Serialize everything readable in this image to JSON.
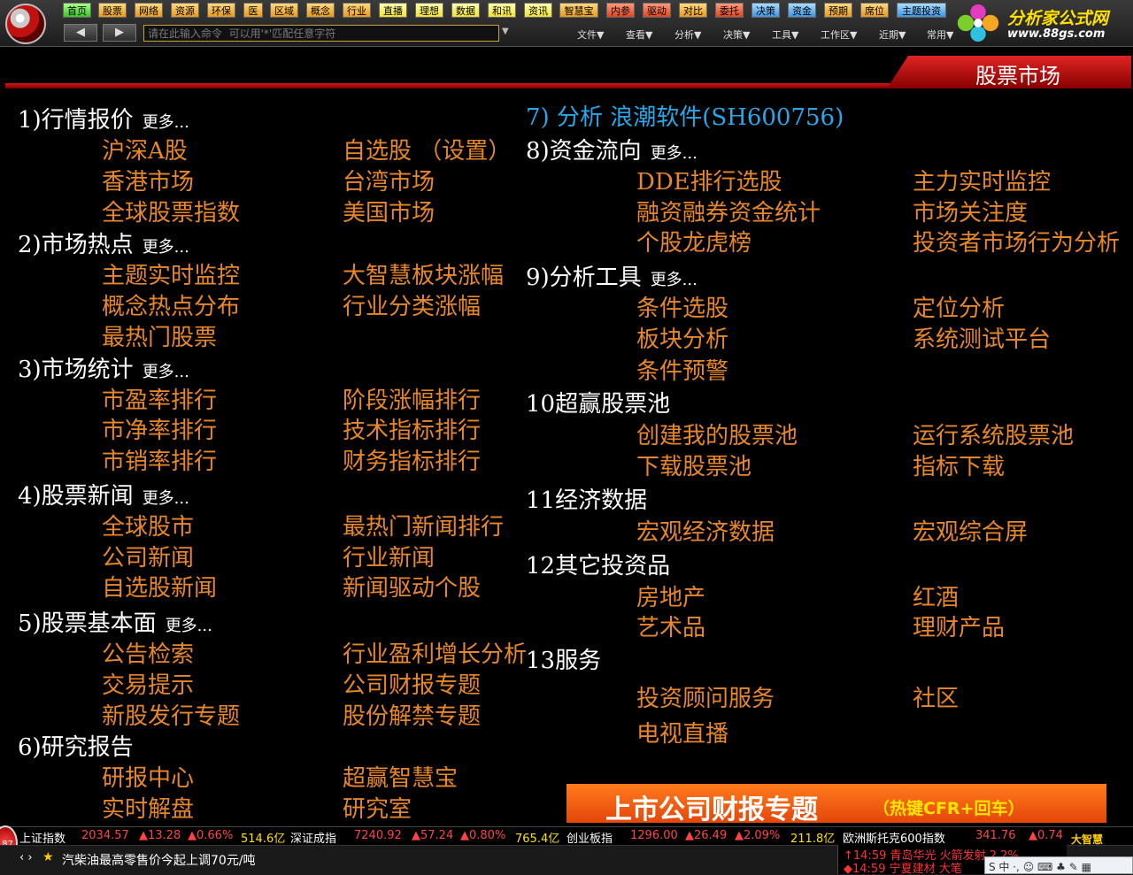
{
  "toolbar": {
    "nav_buttons": [
      "首页",
      "股票",
      "网络",
      "资源",
      "环保",
      "医",
      "区域",
      "概念",
      "行业",
      "直播",
      "理想",
      "数据",
      "和讯",
      "资讯",
      "智慧宝",
      "内参",
      "驱动",
      "对比",
      "委托",
      "决策",
      "资金",
      "预期",
      "席位",
      "主题投资"
    ],
    "command_placeholder": "请在此输入命令  可以用'*'匹配任意字符",
    "menus": [
      "文件▼",
      "查看▼",
      "分析▼",
      "决策▼",
      "工具▼",
      "工作区▼",
      "近期▼",
      "常用▼"
    ],
    "brand_name": "分析家公式网",
    "brand_url": "www.88gs.com"
  },
  "page_title": "股票市场",
  "more_label": "更多...",
  "sections": {
    "s1": {
      "title": "1)行情报价",
      "links": [
        "沪深A股",
        "自选股 （设置）",
        "香港市场",
        "台湾市场",
        "全球股票指数",
        "美国市场"
      ]
    },
    "s2": {
      "title": "2)市场热点",
      "links": [
        "主题实时监控",
        "大智慧板块涨幅",
        "概念热点分布",
        "行业分类涨幅",
        "最热门股票"
      ]
    },
    "s3": {
      "title": "3)市场统计",
      "links": [
        "市盈率排行",
        "阶段涨幅排行",
        "市净率排行",
        "技术指标排行",
        "市销率排行",
        "财务指标排行"
      ]
    },
    "s4": {
      "title": "4)股票新闻",
      "links": [
        "全球股市",
        "最热门新闻排行",
        "公司新闻",
        "行业新闻",
        "自选股新闻",
        "新闻驱动个股"
      ]
    },
    "s5": {
      "title": "5)股票基本面",
      "links": [
        "公告检索",
        "行业盈利增长分析",
        "交易提示",
        "公司财报专题",
        "新股发行专题",
        "股份解禁专题"
      ]
    },
    "s6": {
      "title": "6)研究报告",
      "links": [
        "研报中心",
        "超赢智慧宝",
        "实时解盘",
        "研究室"
      ]
    },
    "s7": {
      "title": "7) 分析  浪潮软件(SH600756)"
    },
    "s8": {
      "title": "8)资金流向",
      "links": [
        "DDE排行选股",
        "主力实时监控",
        "融资融券资金统计",
        "市场关注度",
        "个股龙虎榜",
        "投资者市场行为分析"
      ]
    },
    "s9": {
      "title": "9)分析工具",
      "links": [
        "条件选股",
        "定位分析",
        "板块分析",
        "系统测试平台",
        "条件预警"
      ]
    },
    "s10": {
      "title": "10超赢股票池",
      "links": [
        "创建我的股票池",
        "运行系统股票池",
        "下载股票池",
        "指标下载"
      ]
    },
    "s11": {
      "title": "11经济数据",
      "links": [
        "宏观经济数据",
        "宏观综合屏"
      ]
    },
    "s12": {
      "title": "12其它投资品",
      "links": [
        "房地产",
        "红酒",
        "艺术品",
        "理财产品"
      ]
    },
    "s13": {
      "title": "13服务",
      "links": [
        "投资顾问服务",
        "社区",
        "电视直播"
      ]
    }
  },
  "banner": {
    "title": "上市公司财报专题",
    "hotkey": "（热键CFR+回车）"
  },
  "ticker": {
    "badge": "87",
    "items": [
      {
        "name": "上证指数",
        "value": "2034.57",
        "change": "▲13.28",
        "pct": "▲0.66%",
        "amount": "514.6亿"
      },
      {
        "name": "深证成指",
        "value": "7240.92",
        "change": "▲57.24",
        "pct": "▲0.80%",
        "amount": "765.4亿"
      },
      {
        "name": "创业板指",
        "value": "1296.00",
        "change": "▲26.49",
        "pct": "▲2.09%",
        "amount": "211.8亿"
      },
      {
        "name": "欧洲斯托克600指数",
        "value": "341.76",
        "change": "▲0.74"
      }
    ],
    "logo": "大智慧"
  },
  "news": {
    "controls": "‹ ›",
    "star": "★",
    "text": "汽柴油最高零售价今起上调70元/吨"
  },
  "alerts": [
    "↑14:59 青岛华光 火箭发射 2.2%",
    "◆14:59 宁夏建材 大笔"
  ],
  "tray": "S 中 ·, ☺ ⌨ ♣ ✎ ▦"
}
